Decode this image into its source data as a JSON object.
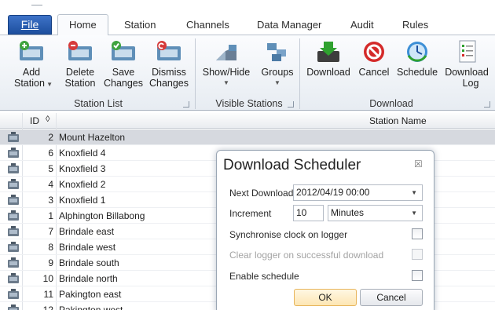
{
  "tabs": {
    "file": "File",
    "home": "Home",
    "station": "Station",
    "channels": "Channels",
    "data_manager": "Data Manager",
    "audit": "Audit",
    "rules": "Rules"
  },
  "ribbon": {
    "add_station": [
      "Add",
      "Station"
    ],
    "delete_station": [
      "Delete",
      "Station"
    ],
    "save_changes": [
      "Save",
      "Changes"
    ],
    "dismiss_changes": [
      "Dismiss",
      "Changes"
    ],
    "show_hide": "Show/Hide",
    "groups": "Groups",
    "download": "Download",
    "cancel": "Cancel",
    "schedule": "Schedule",
    "download_log": [
      "Download",
      "Log"
    ],
    "group_station_list": "Station List",
    "group_visible_stations": "Visible Stations",
    "group_download": "Download"
  },
  "grid": {
    "col_id": "ID",
    "col_name": "Station Name",
    "rows": [
      {
        "id": "2",
        "name": "Mount Hazelton"
      },
      {
        "id": "6",
        "name": "Knoxfield 4"
      },
      {
        "id": "5",
        "name": "Knoxfield 3"
      },
      {
        "id": "4",
        "name": "Knoxfield 2"
      },
      {
        "id": "3",
        "name": "Knoxfield 1"
      },
      {
        "id": "1",
        "name": "Alphington Billabong"
      },
      {
        "id": "7",
        "name": "Brindale east"
      },
      {
        "id": "8",
        "name": "Brindale west"
      },
      {
        "id": "9",
        "name": "Brindale south"
      },
      {
        "id": "10",
        "name": "Brindale north"
      },
      {
        "id": "11",
        "name": "Pakington east"
      },
      {
        "id": "12",
        "name": "Pakington west"
      }
    ]
  },
  "dialog": {
    "title": "Download Scheduler",
    "close": "☒",
    "next_download_label": "Next Download",
    "next_download_value": "2012/04/19 00:00",
    "increment_label": "Increment",
    "increment_value": "10",
    "increment_unit": "Minutes",
    "sync_clock_label": "Synchronise clock on logger",
    "clear_logger_label": "Clear logger on successful download",
    "enable_schedule_label": "Enable schedule",
    "ok_label": "OK",
    "cancel_label": "Cancel"
  }
}
